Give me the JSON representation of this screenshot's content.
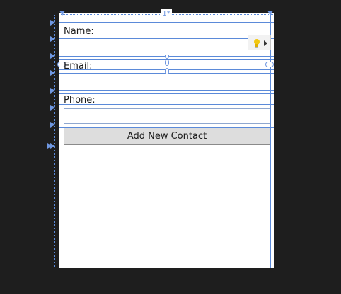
{
  "form": {
    "name_label": "Name:",
    "name_value": "",
    "email_label": "Email:",
    "email_value": "",
    "phone_label": "Phone:",
    "phone_value": "",
    "add_button_label": "Add New Contact"
  },
  "designer": {
    "column_definition": "1*",
    "smart_tag_icon": "lightbulb-icon",
    "smart_tag_arrow": "triangle-right-icon"
  },
  "colors": {
    "background": "#1e1e1e",
    "surface": "#ffffff",
    "guide": "#5b8ad9",
    "button": "#dddddd",
    "lightbulb": "#f2c811"
  }
}
